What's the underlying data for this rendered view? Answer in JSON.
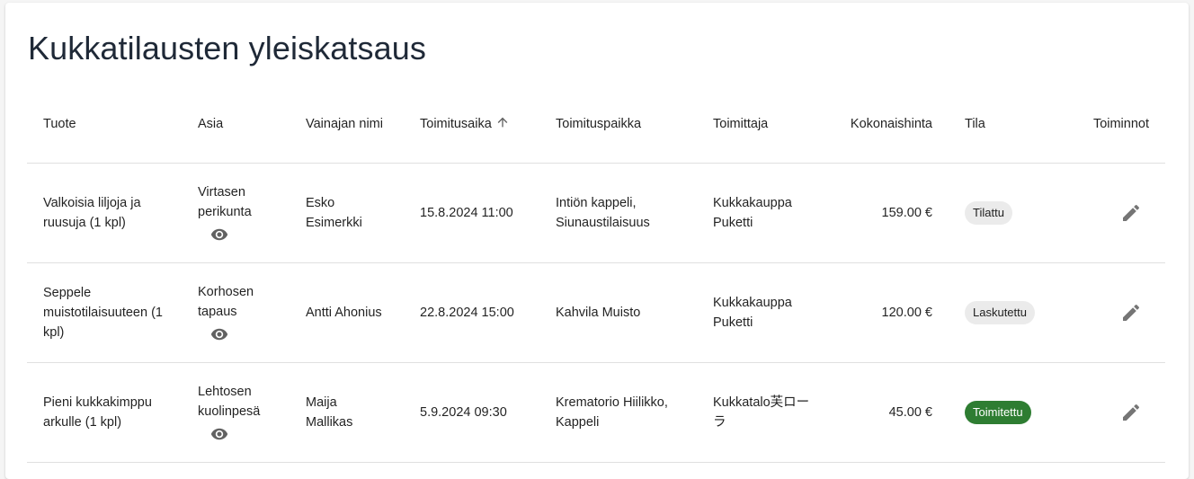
{
  "title": "Kukkatilausten yleiskatsaus",
  "columns": {
    "product": "Tuote",
    "matter": "Asia",
    "deceased": "Vainajan nimi",
    "delivery_time": "Toimitusaika",
    "delivery_place": "Toimituspaikka",
    "supplier": "Toimittaja",
    "total": "Kokonaishinta",
    "status": "Tila",
    "actions": "Toiminnot"
  },
  "sort": {
    "column": "delivery_time",
    "direction": "ascending",
    "icon": "arrow-up-icon"
  },
  "rows": [
    {
      "product": "Valkoisia liljoja ja ruusuja (1 kpl)",
      "matter": "Virtasen perikunta",
      "deceased": "Esko Esimerkki",
      "delivery_time": "15.8.2024 11:00",
      "delivery_place": "Intiön kappeli, Siunaustilaisuus",
      "supplier": "Kukkakauppa Puketti",
      "total": "159.00 €",
      "status": "Tilattu"
    },
    {
      "product": "Seppele muistotilaisuuteen (1 kpl)",
      "matter": "Korhosen tapaus",
      "deceased": "Antti Ahonius",
      "delivery_time": "22.8.2024 15:00",
      "delivery_place": "Kahvila Muisto",
      "supplier": "Kukkakauppa Puketti",
      "total": "120.00 €",
      "status": "Laskutettu"
    },
    {
      "product": "Pieni kukkakimppu arkulle (1 kpl)",
      "matter": "Lehtosen kuolinpesä",
      "deceased": "Maija Mallikas",
      "delivery_time": "5.9.2024 09:30",
      "delivery_place": "Krematorio Hiilikko, Kappeli",
      "supplier": "Kukkatalo芙ローラ",
      "total": "45.00 €",
      "status": "Toimitettu"
    }
  ],
  "colors": {
    "status_default_bg": "#ebebeb",
    "status_done_bg": "#2e7d32",
    "icon": "#757575",
    "title": "#1f2937"
  },
  "icons": {
    "view": "eye-icon",
    "edit": "pencil-icon"
  }
}
